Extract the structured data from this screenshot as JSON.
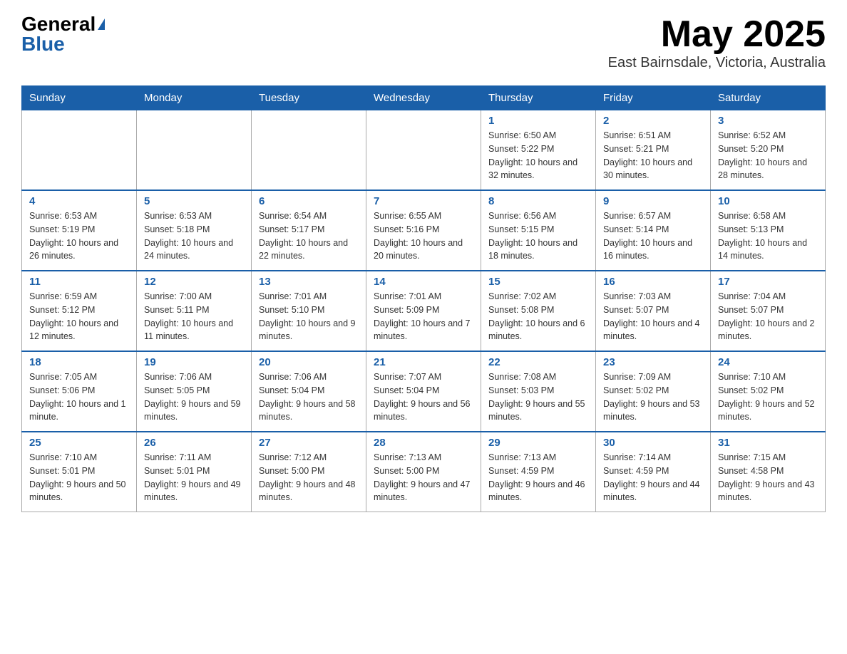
{
  "header": {
    "logo_general": "General",
    "logo_blue": "Blue",
    "month_title": "May 2025",
    "location": "East Bairnsdale, Victoria, Australia"
  },
  "days_of_week": [
    "Sunday",
    "Monday",
    "Tuesday",
    "Wednesday",
    "Thursday",
    "Friday",
    "Saturday"
  ],
  "weeks": [
    [
      {
        "day": "",
        "info": ""
      },
      {
        "day": "",
        "info": ""
      },
      {
        "day": "",
        "info": ""
      },
      {
        "day": "",
        "info": ""
      },
      {
        "day": "1",
        "info": "Sunrise: 6:50 AM\nSunset: 5:22 PM\nDaylight: 10 hours and 32 minutes."
      },
      {
        "day": "2",
        "info": "Sunrise: 6:51 AM\nSunset: 5:21 PM\nDaylight: 10 hours and 30 minutes."
      },
      {
        "day": "3",
        "info": "Sunrise: 6:52 AM\nSunset: 5:20 PM\nDaylight: 10 hours and 28 minutes."
      }
    ],
    [
      {
        "day": "4",
        "info": "Sunrise: 6:53 AM\nSunset: 5:19 PM\nDaylight: 10 hours and 26 minutes."
      },
      {
        "day": "5",
        "info": "Sunrise: 6:53 AM\nSunset: 5:18 PM\nDaylight: 10 hours and 24 minutes."
      },
      {
        "day": "6",
        "info": "Sunrise: 6:54 AM\nSunset: 5:17 PM\nDaylight: 10 hours and 22 minutes."
      },
      {
        "day": "7",
        "info": "Sunrise: 6:55 AM\nSunset: 5:16 PM\nDaylight: 10 hours and 20 minutes."
      },
      {
        "day": "8",
        "info": "Sunrise: 6:56 AM\nSunset: 5:15 PM\nDaylight: 10 hours and 18 minutes."
      },
      {
        "day": "9",
        "info": "Sunrise: 6:57 AM\nSunset: 5:14 PM\nDaylight: 10 hours and 16 minutes."
      },
      {
        "day": "10",
        "info": "Sunrise: 6:58 AM\nSunset: 5:13 PM\nDaylight: 10 hours and 14 minutes."
      }
    ],
    [
      {
        "day": "11",
        "info": "Sunrise: 6:59 AM\nSunset: 5:12 PM\nDaylight: 10 hours and 12 minutes."
      },
      {
        "day": "12",
        "info": "Sunrise: 7:00 AM\nSunset: 5:11 PM\nDaylight: 10 hours and 11 minutes."
      },
      {
        "day": "13",
        "info": "Sunrise: 7:01 AM\nSunset: 5:10 PM\nDaylight: 10 hours and 9 minutes."
      },
      {
        "day": "14",
        "info": "Sunrise: 7:01 AM\nSunset: 5:09 PM\nDaylight: 10 hours and 7 minutes."
      },
      {
        "day": "15",
        "info": "Sunrise: 7:02 AM\nSunset: 5:08 PM\nDaylight: 10 hours and 6 minutes."
      },
      {
        "day": "16",
        "info": "Sunrise: 7:03 AM\nSunset: 5:07 PM\nDaylight: 10 hours and 4 minutes."
      },
      {
        "day": "17",
        "info": "Sunrise: 7:04 AM\nSunset: 5:07 PM\nDaylight: 10 hours and 2 minutes."
      }
    ],
    [
      {
        "day": "18",
        "info": "Sunrise: 7:05 AM\nSunset: 5:06 PM\nDaylight: 10 hours and 1 minute."
      },
      {
        "day": "19",
        "info": "Sunrise: 7:06 AM\nSunset: 5:05 PM\nDaylight: 9 hours and 59 minutes."
      },
      {
        "day": "20",
        "info": "Sunrise: 7:06 AM\nSunset: 5:04 PM\nDaylight: 9 hours and 58 minutes."
      },
      {
        "day": "21",
        "info": "Sunrise: 7:07 AM\nSunset: 5:04 PM\nDaylight: 9 hours and 56 minutes."
      },
      {
        "day": "22",
        "info": "Sunrise: 7:08 AM\nSunset: 5:03 PM\nDaylight: 9 hours and 55 minutes."
      },
      {
        "day": "23",
        "info": "Sunrise: 7:09 AM\nSunset: 5:02 PM\nDaylight: 9 hours and 53 minutes."
      },
      {
        "day": "24",
        "info": "Sunrise: 7:10 AM\nSunset: 5:02 PM\nDaylight: 9 hours and 52 minutes."
      }
    ],
    [
      {
        "day": "25",
        "info": "Sunrise: 7:10 AM\nSunset: 5:01 PM\nDaylight: 9 hours and 50 minutes."
      },
      {
        "day": "26",
        "info": "Sunrise: 7:11 AM\nSunset: 5:01 PM\nDaylight: 9 hours and 49 minutes."
      },
      {
        "day": "27",
        "info": "Sunrise: 7:12 AM\nSunset: 5:00 PM\nDaylight: 9 hours and 48 minutes."
      },
      {
        "day": "28",
        "info": "Sunrise: 7:13 AM\nSunset: 5:00 PM\nDaylight: 9 hours and 47 minutes."
      },
      {
        "day": "29",
        "info": "Sunrise: 7:13 AM\nSunset: 4:59 PM\nDaylight: 9 hours and 46 minutes."
      },
      {
        "day": "30",
        "info": "Sunrise: 7:14 AM\nSunset: 4:59 PM\nDaylight: 9 hours and 44 minutes."
      },
      {
        "day": "31",
        "info": "Sunrise: 7:15 AM\nSunset: 4:58 PM\nDaylight: 9 hours and 43 minutes."
      }
    ]
  ]
}
